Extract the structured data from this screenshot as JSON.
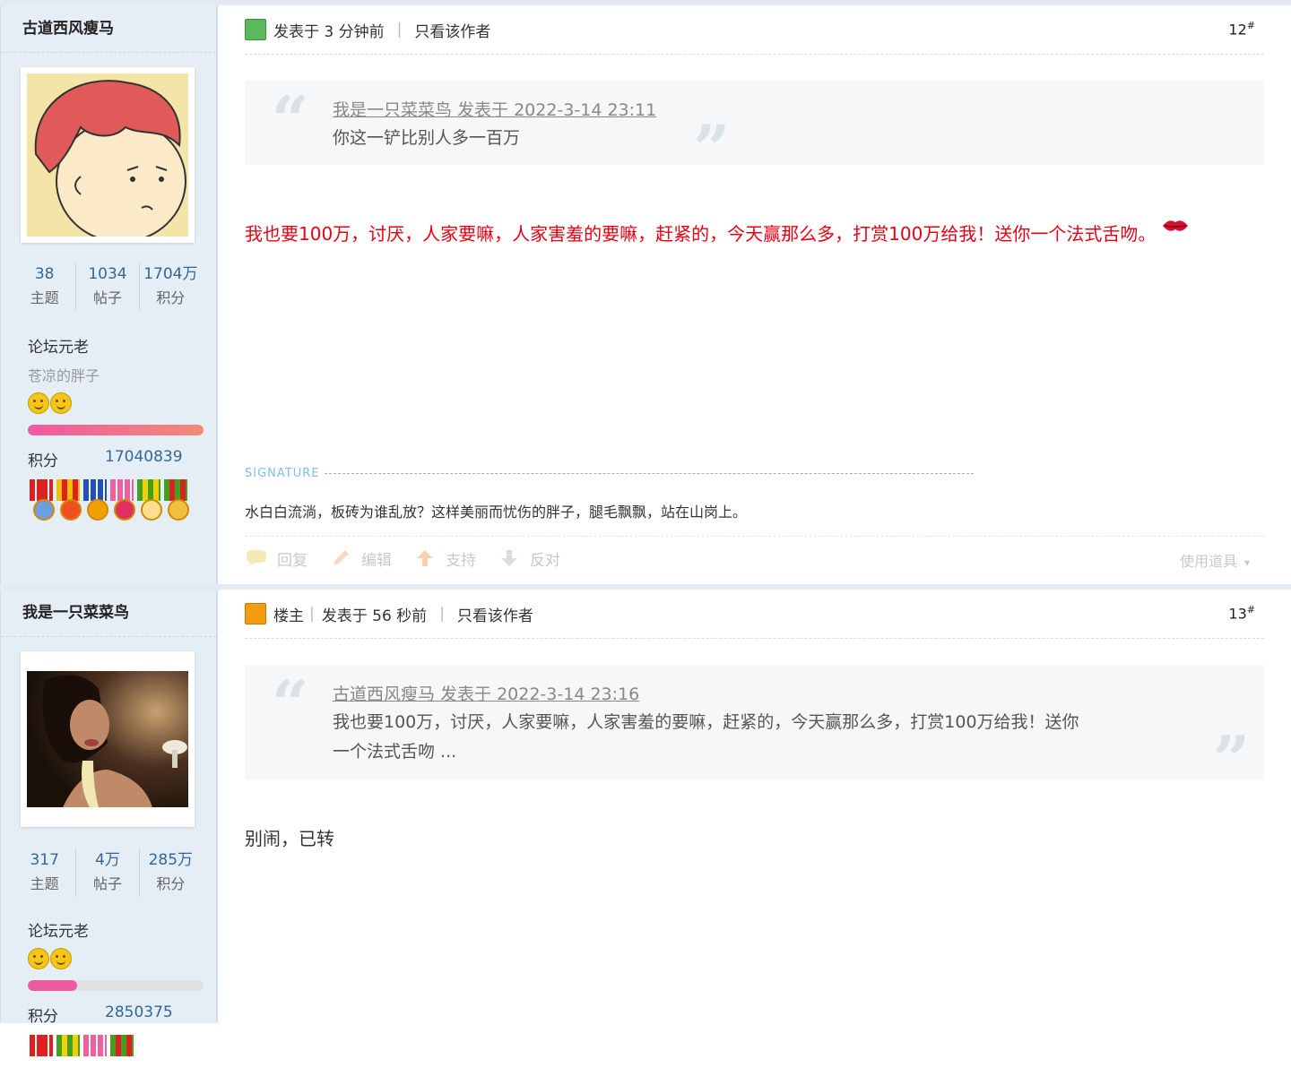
{
  "posts": [
    {
      "author": "古道西风瘦马",
      "stats": [
        {
          "num": "38",
          "label": "主题"
        },
        {
          "num": "1034",
          "label": "帖子"
        },
        {
          "num": "1704万",
          "label": "积分"
        }
      ],
      "rank": "论坛元老",
      "title_sub": "苍凉的胖子",
      "level_fill": 1.0,
      "score_label": "积分",
      "score_value": "17040839",
      "header": {
        "posted": "发表于 3 分钟前",
        "only_author": "只看该作者",
        "floor": "12",
        "floor_sup": "#"
      },
      "quote": {
        "meta": "我是一只菜菜鸟 发表于 2022-3-14 23:11",
        "text": "你这一铲比别人多一百万"
      },
      "content": "我也要100万，讨厌，人家要嘛，人家害羞的要嘛，赶紧的，今天赢那么多，打赏100万给我！送你一个法式舌吻。",
      "signature_label": "SIGNATURE",
      "signature": "水白白流淌，板砖为谁乱放？这样美丽而忧伤的胖子，腿毛飘飘，站在山岗上。",
      "actions": {
        "reply": "回复",
        "edit": "编辑",
        "support": "支持",
        "oppose": "反对",
        "tools": "使用道具"
      }
    },
    {
      "author": "我是一只菜菜鸟",
      "stats": [
        {
          "num": "317",
          "label": "主题"
        },
        {
          "num": "4万",
          "label": "帖子"
        },
        {
          "num": "285万",
          "label": "积分"
        }
      ],
      "rank": "论坛元老",
      "level_fill": 0.28,
      "score_label": "积分",
      "score_value": "2850375",
      "header": {
        "op_label": "楼主",
        "posted": "发表于 56 秒前",
        "only_author": "只看该作者",
        "floor": "13",
        "floor_sup": "#"
      },
      "quote": {
        "meta": "古道西风瘦马 发表于 2022-3-14 23:16",
        "text_line1": "我也要100万，讨厌，人家要嘛，人家害羞的要嘛，赶紧的，今天赢那么多，打赏100万给我！送你",
        "text_line2": "一个法式舌吻 ..."
      },
      "content": "别闹，已转"
    }
  ],
  "colors": {
    "accent_red": "#e60012",
    "link_blue": "#336699",
    "sidebar_bg": "#e6eef5"
  }
}
